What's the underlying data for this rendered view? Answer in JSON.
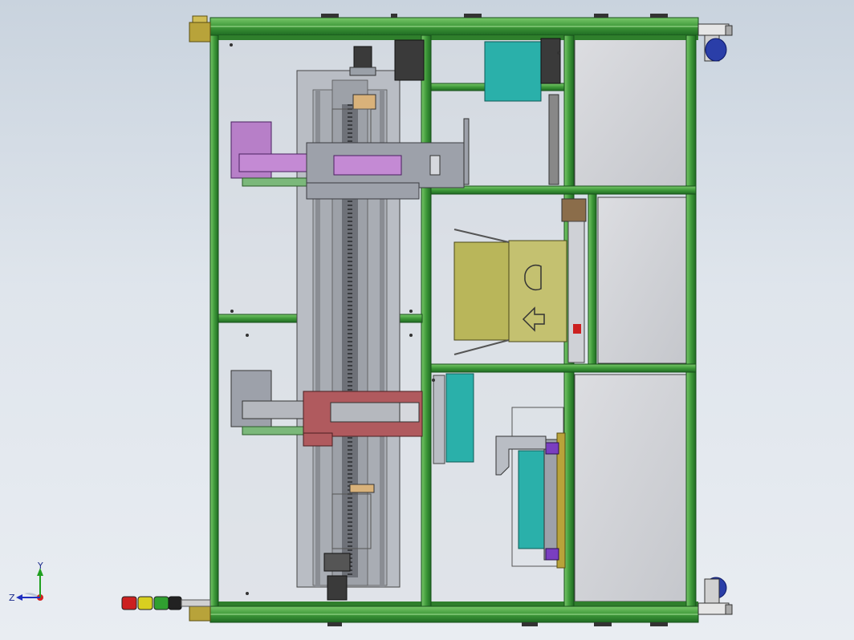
{
  "viewport": {
    "background_top": "#c9d3de",
    "background_bottom": "#e9edf2"
  },
  "colors": {
    "frame_green": "#3f9a3a",
    "frame_green_dark": "#1f6b22",
    "frame_green_light": "#6cc05e",
    "panel_gray": "#c8c9cd",
    "plate_gray": "#b9bdc4",
    "purple_slide": "#b77fc8",
    "red_slide": "#b05a5e",
    "yellow_box": "#b9b65a",
    "teal_block": "#2ab0aa",
    "mount_yellow": "#b8a33a",
    "caster_blue": "#2a3ea8"
  },
  "triad": {
    "y_label": "Y",
    "z_label": "Z",
    "x_color": "#d42020",
    "y_color": "#20a020",
    "z_color": "#2030c0"
  },
  "signal_tower": {
    "segments": [
      "#cc2020",
      "#d8d020",
      "#30a030",
      "#222222"
    ]
  }
}
